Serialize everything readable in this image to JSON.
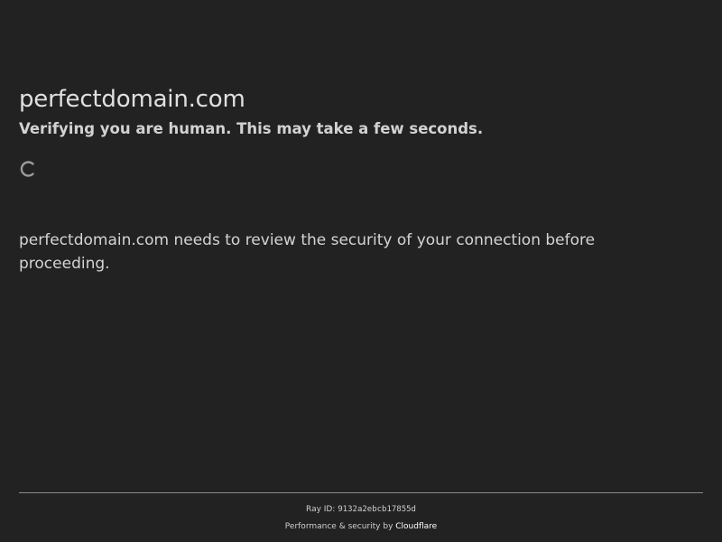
{
  "header": {
    "site_name": "perfectdomain.com",
    "verifying_text": "Verifying you are human. This may take a few seconds."
  },
  "spinner": {
    "icon": "loading-spinner-icon"
  },
  "body": {
    "review_text": "perfectdomain.com needs to review the security of your connection before proceeding."
  },
  "footer": {
    "ray_label": "Ray ID: ",
    "ray_id": "9132a2ebcb17855d",
    "perf_label": "Performance & security by ",
    "provider_link": "Cloudflare"
  },
  "colors": {
    "background": "#222222",
    "text": "#d9d9d9",
    "divider": "#8a8a8a"
  }
}
